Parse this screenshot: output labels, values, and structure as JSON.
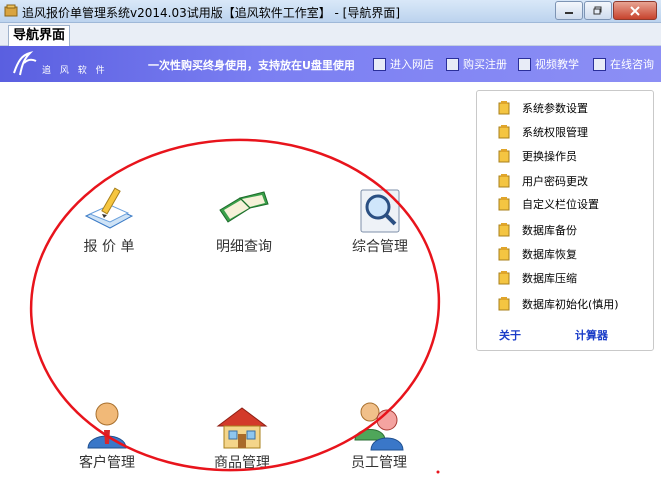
{
  "window": {
    "title": "追风报价单管理系统v2014.03试用版【追风软件工作室】 - [导航界面]"
  },
  "tab": {
    "label": "导航界面"
  },
  "banner": {
    "logo_text": "追 风 软 件",
    "slogan": "一次性购买终身使用，支持放在U盘里使用",
    "links": [
      "进入网店",
      "购买注册",
      "视频教学",
      "在线咨询"
    ]
  },
  "main_icons": {
    "quote": "报 价 单",
    "detail_query": "明细查询",
    "general_manage": "综合管理",
    "customer_manage": "客户管理",
    "product_manage": "商品管理",
    "staff_manage": "员工管理"
  },
  "side_menu": {
    "items": [
      "系统参数设置",
      "系统权限管理",
      "更换操作员",
      "用户密码更改",
      "自定义栏位设置",
      "数据库备份",
      "数据库恢复",
      "数据库压缩",
      "数据库初始化(慎用)"
    ],
    "about": "关于",
    "calculator": "计算器"
  },
  "colors": {
    "banner": "#7b7ff2",
    "annotation": "#e8141c",
    "link": "#1a3cc8"
  }
}
